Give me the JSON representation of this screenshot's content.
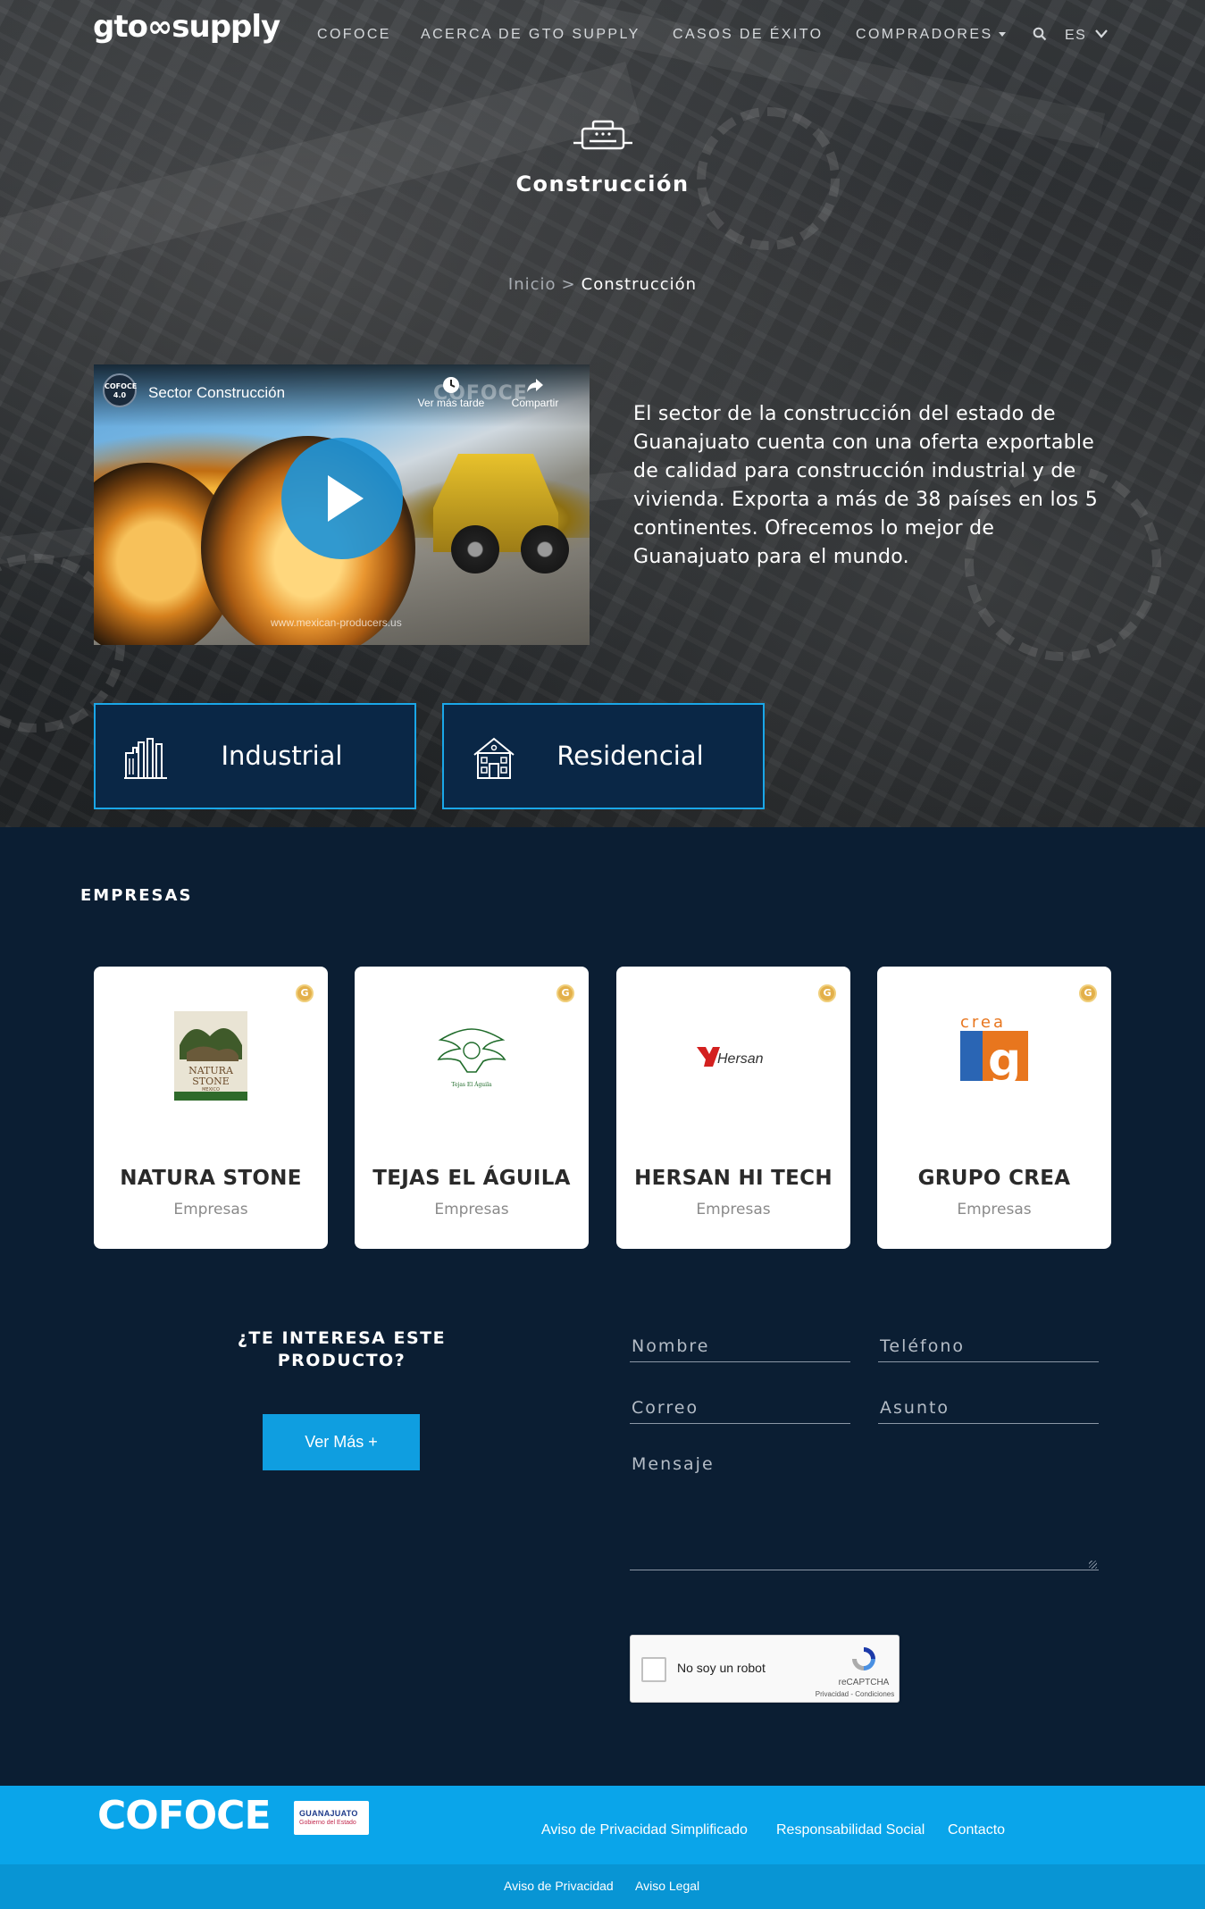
{
  "header": {
    "logo_text": "gtosupply",
    "nav": [
      {
        "label": "COFOCE"
      },
      {
        "label": "ACERCA DE GTO SUPPLY"
      },
      {
        "label": "CASOS DE ÉXITO"
      },
      {
        "label": "COMPRADORES"
      }
    ],
    "language": "ES",
    "search_icon": "search-icon"
  },
  "hero": {
    "category_icon": "construction-category-icon",
    "title": "Construcción",
    "breadcrumb": {
      "home": "Inicio",
      "separator": ">",
      "current": "Construcción"
    },
    "video": {
      "channel": "COFOCE 4.0",
      "title": "Sector Construcción",
      "watch_later": "Ver más tarde",
      "share": "Compartir",
      "watermark": "COFOCE",
      "url": "www.mexican-producers.us"
    },
    "description": "El sector de la construcción del estado de Guanajuato cuenta con una oferta exportable de calidad para construcción industrial y de vivienda. Exporta a más de 38 países en los 5 continentes. Ofrecemos lo mejor de Guanajuato para el mundo.",
    "subcategories": [
      {
        "label": "Industrial",
        "icon": "factory-icon"
      },
      {
        "label": "Residencial",
        "icon": "house-icon"
      }
    ]
  },
  "companies": {
    "title": "EMPRESAS",
    "badge": "G",
    "items": [
      {
        "name": "NATURA STONE",
        "type": "Empresas",
        "logo_text_1": "NATURA",
        "logo_text_2": "STONE",
        "logo_text_3": "MEXICO"
      },
      {
        "name": "TEJAS EL ÁGUILA",
        "type": "Empresas",
        "logo_text_1": "Tejas El Águila"
      },
      {
        "name": "HERSAN HI TECH",
        "type": "Empresas",
        "logo_text_1": "Hersan"
      },
      {
        "name": "GRUPO CREA",
        "type": "Empresas",
        "logo_text_1": "crea",
        "logo_text_2": "g"
      }
    ]
  },
  "cta": {
    "question": "¿TE INTERESA ESTE PRODUCTO?",
    "button": "Ver Más +"
  },
  "form": {
    "name_placeholder": "Nombre",
    "phone_placeholder": "Teléfono",
    "email_placeholder": "Correo",
    "subject_placeholder": "Asunto",
    "message_placeholder": "Mensaje",
    "captcha_label": "No soy un robot",
    "captcha_brand": "reCAPTCHA",
    "captcha_links": "Privacidad - Condiciones"
  },
  "footer": {
    "brand": "COFOCE",
    "gov_badge_line1": "GUANAJUATO",
    "gov_badge_line2": "Gobierno del Estado",
    "links": [
      "Aviso de Privacidad Simplificado",
      "Responsabilidad Social",
      "Contacto"
    ],
    "sub_links": [
      "Aviso de Privacidad",
      "Aviso Legal"
    ]
  },
  "colors": {
    "page_bg": "#0b1e33",
    "accent": "#0aa5ea",
    "button": "#0f9ee0",
    "subcategory_border": "#1aa7e8",
    "badge": "#e3b04b"
  }
}
